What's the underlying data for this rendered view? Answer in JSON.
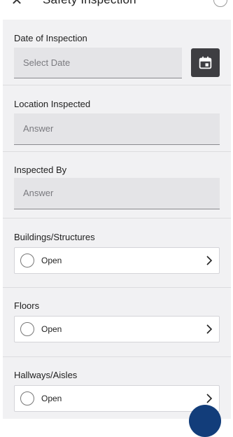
{
  "header": {
    "title": "Safety Inspection",
    "close_icon": "close-icon"
  },
  "fields": {
    "date": {
      "label": "Date of Inspection",
      "placeholder": "Select Date"
    },
    "location": {
      "label": "Location Inspected",
      "placeholder": "Answer"
    },
    "inspected_by": {
      "label": "Inspected By",
      "placeholder": "Answer"
    }
  },
  "checklist": [
    {
      "label": "Buildings/Structures",
      "status": "Open"
    },
    {
      "label": "Floors",
      "status": "Open"
    },
    {
      "label": "Hallways/Aisles",
      "status": "Open"
    }
  ],
  "colors": {
    "calendar_button": "#3e3e42",
    "fab": "#123d7a",
    "form_background": "#f1f1f3"
  }
}
